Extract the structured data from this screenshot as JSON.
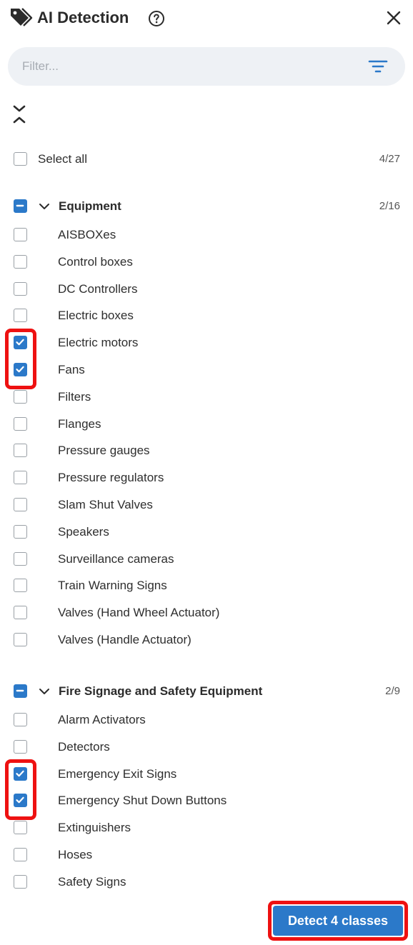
{
  "header": {
    "title": "AI Detection"
  },
  "filter": {
    "placeholder": "Filter..."
  },
  "select_all": {
    "label": "Select all",
    "count": "4/27"
  },
  "groups": [
    {
      "name": "Equipment",
      "count": "2/16",
      "state": "mixed",
      "items": [
        {
          "label": "AISBOXes",
          "checked": false
        },
        {
          "label": "Control boxes",
          "checked": false
        },
        {
          "label": "DC Controllers",
          "checked": false
        },
        {
          "label": "Electric boxes",
          "checked": false
        },
        {
          "label": "Electric motors",
          "checked": true
        },
        {
          "label": "Fans",
          "checked": true
        },
        {
          "label": "Filters",
          "checked": false
        },
        {
          "label": "Flanges",
          "checked": false
        },
        {
          "label": "Pressure gauges",
          "checked": false
        },
        {
          "label": "Pressure regulators",
          "checked": false
        },
        {
          "label": "Slam Shut Valves",
          "checked": false
        },
        {
          "label": "Speakers",
          "checked": false
        },
        {
          "label": "Surveillance cameras",
          "checked": false
        },
        {
          "label": "Train Warning Signs",
          "checked": false
        },
        {
          "label": "Valves (Hand Wheel Actuator)",
          "checked": false
        },
        {
          "label": "Valves (Handle Actuator)",
          "checked": false
        }
      ]
    },
    {
      "name": "Fire Signage and Safety Equipment",
      "count": "2/9",
      "state": "mixed",
      "items": [
        {
          "label": "Alarm Activators",
          "checked": false
        },
        {
          "label": "Detectors",
          "checked": false
        },
        {
          "label": "Emergency Exit Signs",
          "checked": true
        },
        {
          "label": "Emergency Shut Down Buttons",
          "checked": true
        },
        {
          "label": "Extinguishers",
          "checked": false
        },
        {
          "label": "Hoses",
          "checked": false
        },
        {
          "label": "Safety Signs",
          "checked": false
        }
      ]
    }
  ],
  "detect_button": {
    "label": "Detect 4 classes"
  },
  "colors": {
    "accent": "#2b79c9",
    "highlight": "#ee1111",
    "filter_bg": "#eef1f5"
  }
}
